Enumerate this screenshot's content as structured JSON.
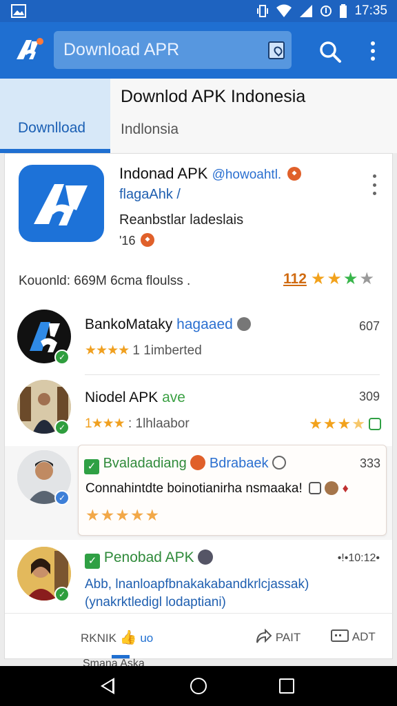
{
  "status_bar": {
    "time": "17:35"
  },
  "app_bar": {
    "search_placeholder": "Download APR"
  },
  "tabs": {
    "active_tab": "Downlload",
    "title": "Downlod APK Indonesia",
    "subtitle": "Indlonsia"
  },
  "hero": {
    "title": "Indonad APK",
    "handle": "@howoahtl.",
    "developer": "flagaAhk /",
    "description": "Reanbstlar ladeslais",
    "meta": "'16",
    "stats": "Kouonld: 669M 6cma floulss .",
    "rating": "112"
  },
  "items": [
    {
      "title": "BankoMataky",
      "tag": "hagaaed",
      "subtitle": "1 1imberted",
      "stars": "★★★★",
      "count": "607"
    },
    {
      "title": "Niodel APK",
      "tag": "ave",
      "subtitle": ": 1lhlaabor",
      "stars": "1★★★",
      "count": "309"
    },
    {
      "title": "Bvaladadiang",
      "tag": "Bdrabaek",
      "subtitle": "Connahintdte boinotianirha nsmaaka!",
      "stars": "★★★★★",
      "count": "333"
    },
    {
      "title": "Penobad APK",
      "meta": "•!•10:12•",
      "subtitle": "Abb, lnanloapfbnakakabandkrlcjassak)",
      "subtitle2": "(ynakrktledigl lodaptiani)"
    }
  ],
  "bottom_actions": {
    "left": "RKNIK",
    "left_tag": "uo",
    "middle": "PAIT",
    "right": "ADT"
  },
  "below_text": "Smana Aska"
}
